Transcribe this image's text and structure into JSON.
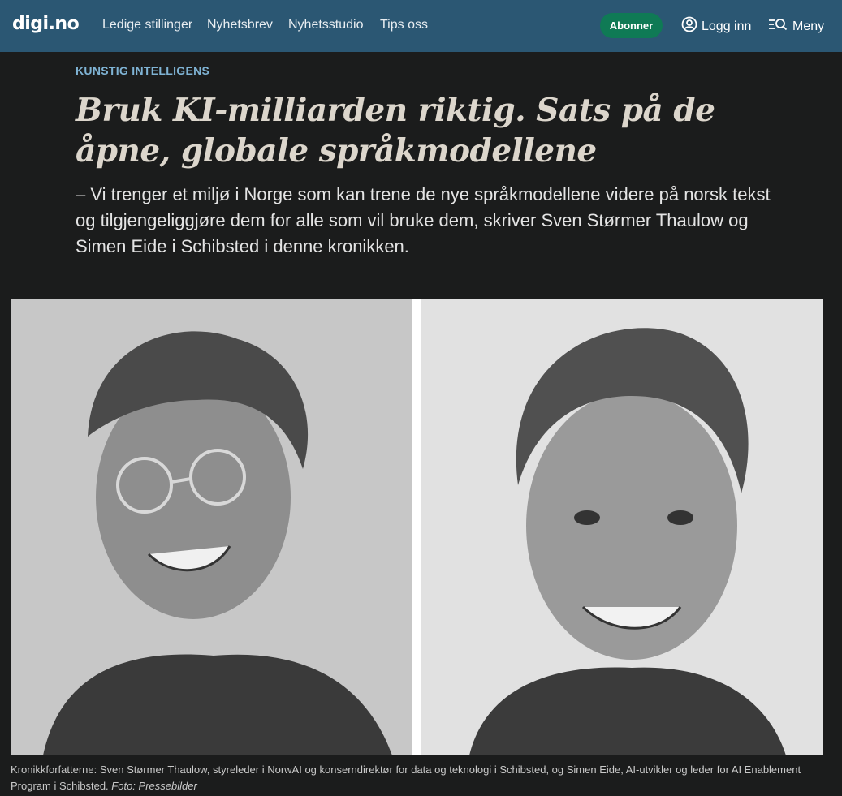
{
  "header": {
    "logo": "digi.no",
    "nav": [
      "Ledige stillinger",
      "Nyhetsbrev",
      "Nyhetsstudio",
      "Tips oss"
    ],
    "subscribe_label": "Abonner",
    "login_label": "Logg inn",
    "menu_label": "Meny",
    "colors": {
      "bar": "#2b5773",
      "subscribe": "#0f7a55"
    }
  },
  "article": {
    "kicker": "KUNSTIG INTELLIGENS",
    "headline": "Bruk KI-milliarden riktig. Sats på de åpne, globale språkmodellene",
    "lead": "– Vi trenger et miljø i Norge som kan trene de nye språkmodellene videre på norsk tekst og tilgjengeliggjøre dem for alle som vil bruke dem, skriver Sven Størmer Thaulow og Simen Eide i Schibsted i denne kronikken.",
    "caption": "Kronikkforfatterne: Sven Størmer Thaulow, styreleder i NorwAI og konserndirektør for data og teknologi i Schibsted, og Simen Eide, AI-utvikler og leder for AI Enablement Program i Schibsted.",
    "photo_credit": "Foto: Pressebilder"
  },
  "icons": {
    "login": "user-circle-icon",
    "menu": "menu-search-icon"
  }
}
